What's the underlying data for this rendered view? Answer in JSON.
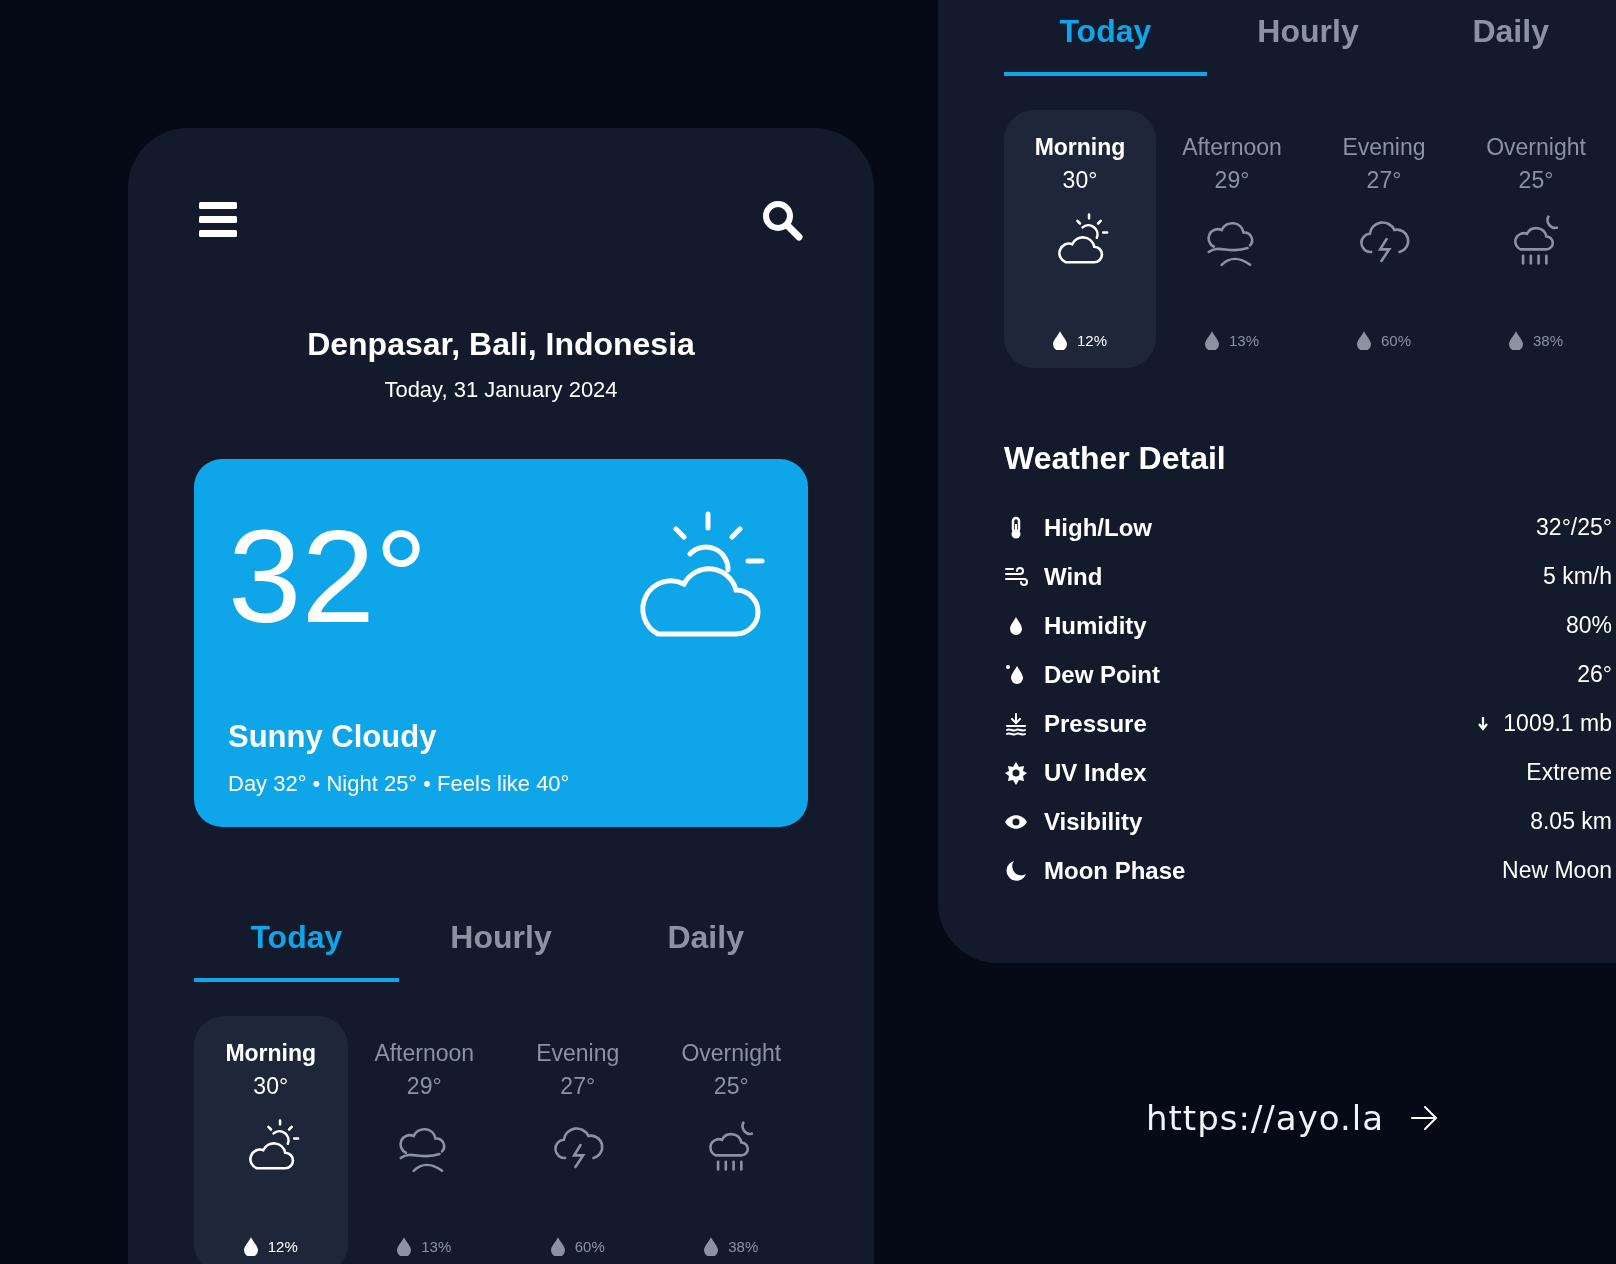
{
  "main_screen": {
    "city": "Denpasar, Bali, Indonesia",
    "date": "Today, 31 January 2024",
    "current": {
      "temperature": "32°",
      "condition": "Sunny Cloudy",
      "summary": "Day 32° • Night 25° • Feels like 40°"
    },
    "tabs": [
      {
        "label": "Today",
        "selected": true
      },
      {
        "label": "Hourly",
        "selected": false
      },
      {
        "label": "Daily",
        "selected": false
      }
    ],
    "periods": [
      {
        "label": "Morning",
        "temperature": "30°",
        "kind": "sun-cloud",
        "precipitation": "12%",
        "selected": true
      },
      {
        "label": "Afternoon",
        "temperature": "29°",
        "kind": "fog",
        "precipitation": "13%",
        "selected": false
      },
      {
        "label": "Evening",
        "temperature": "27°",
        "kind": "storm",
        "precipitation": "60%",
        "selected": false
      },
      {
        "label": "Overnight",
        "temperature": "25°",
        "kind": "night-rain",
        "precipitation": "38%",
        "selected": false
      }
    ]
  },
  "detail_panel": {
    "tabs": [
      {
        "label": "Today",
        "selected": true
      },
      {
        "label": "Hourly",
        "selected": false
      },
      {
        "label": "Daily",
        "selected": false
      }
    ],
    "periods": [
      {
        "label": "Morning",
        "temperature": "30°",
        "kind": "sun-cloud",
        "precipitation": "12%",
        "selected": true
      },
      {
        "label": "Afternoon",
        "temperature": "29°",
        "kind": "fog",
        "precipitation": "13%",
        "selected": false
      },
      {
        "label": "Evening",
        "temperature": "27°",
        "kind": "storm",
        "precipitation": "60%",
        "selected": false
      },
      {
        "label": "Overnight",
        "temperature": "25°",
        "kind": "night-rain",
        "precipitation": "38%",
        "selected": false
      }
    ],
    "heading": "Weather Detail",
    "details": [
      {
        "kind": "thermometer",
        "label": "High/Low",
        "value": "32°/25°"
      },
      {
        "kind": "wind",
        "label": "Wind",
        "value": "5 km/h"
      },
      {
        "kind": "drop",
        "label": "Humidity",
        "value": "80%"
      },
      {
        "kind": "dew",
        "label": "Dew Point",
        "value": "26°"
      },
      {
        "kind": "pressure",
        "label": "Pressure",
        "value": "1009.1 mb",
        "falling": true
      },
      {
        "kind": "sun",
        "label": "UV Index",
        "value": "Extreme"
      },
      {
        "kind": "eye",
        "label": "Visibility",
        "value": "8.05 km"
      },
      {
        "kind": "moon",
        "label": "Moon Phase",
        "value": "New Moon"
      }
    ]
  },
  "link": {
    "text": "https://ayo.la"
  }
}
